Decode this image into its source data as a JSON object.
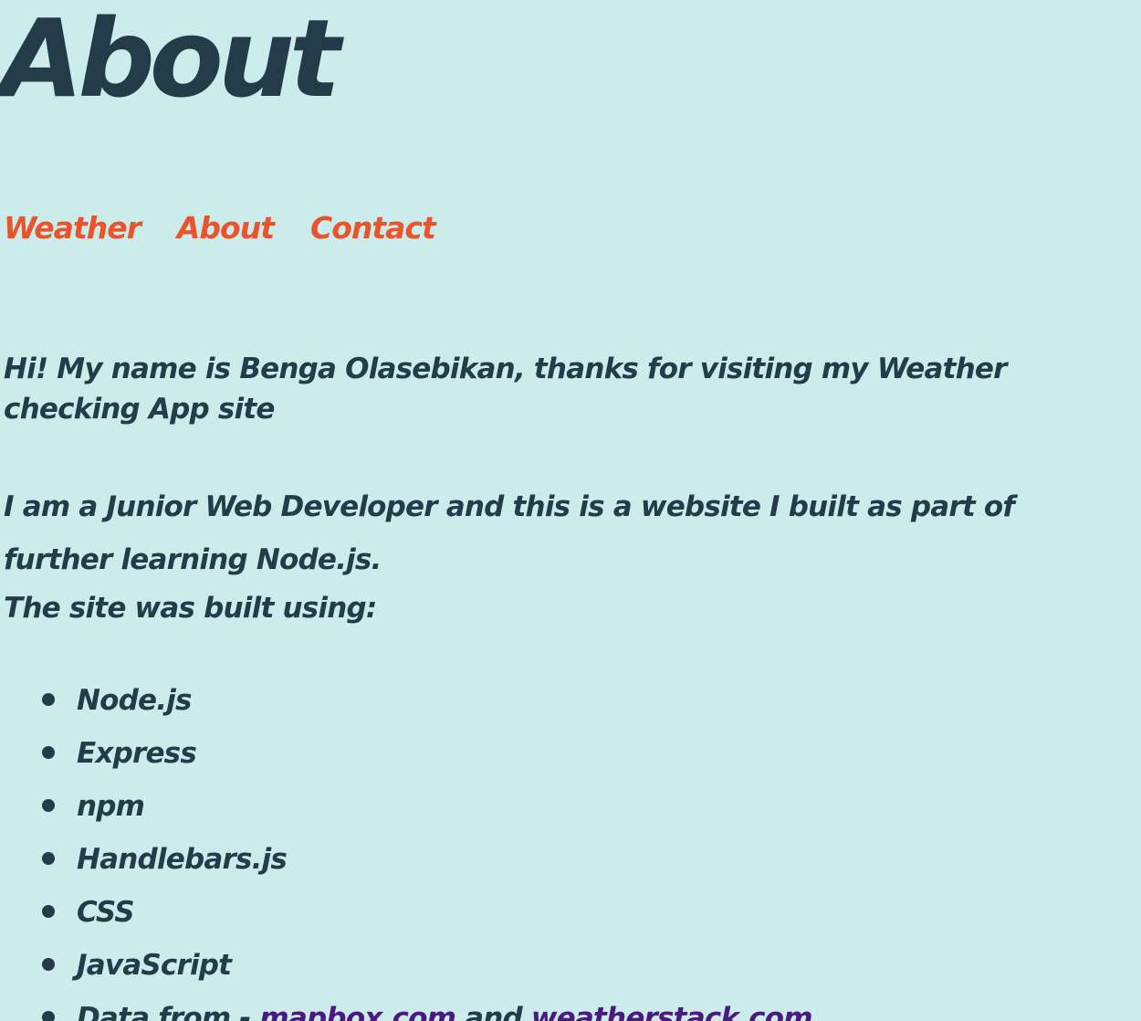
{
  "header": {
    "title": "About"
  },
  "nav": {
    "items": [
      {
        "label": "Weather"
      },
      {
        "label": "About"
      },
      {
        "label": "Contact"
      }
    ]
  },
  "main": {
    "greeting": "Hi! My name is Benga Olasebikan, thanks for visiting my Weather checking App site",
    "intro": "I am a Junior Web Developer and this is a website I built as part of further learning Node.js.",
    "built_using": "The site was built using:",
    "tools": [
      "Node.js",
      "Express",
      "npm",
      "Handlebars.js",
      "CSS",
      "JavaScript"
    ],
    "data_from": {
      "prefix": "Data from - ",
      "link1": "mapbox.com",
      "conjunction": " and ",
      "link2": "weatherstack.com"
    }
  },
  "colors": {
    "background": "#cbeceb",
    "text": "#243b4a",
    "nav_link": "#e9542c",
    "visited_link": "#4b1a7e"
  }
}
